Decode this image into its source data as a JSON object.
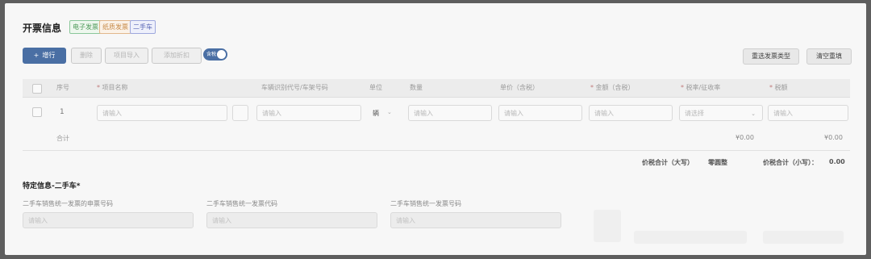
{
  "header": {
    "title": "开票信息",
    "tags": [
      "电子发票",
      "纸质发票",
      "二手车"
    ]
  },
  "toolbar": {
    "add_label": "增行",
    "delete_label": "删除",
    "import_label": "项目导入",
    "discount_label": "添加折扣",
    "toggle_label": "含税",
    "reselect_label": "重选发票类型",
    "clear_label": "清空重填"
  },
  "table": {
    "columns": [
      "序号",
      "项目名称",
      "车辆识别代号/车架号码",
      "单位",
      "数量",
      "单价（含税）",
      "金额（含税）",
      "税率/征收率",
      "税额"
    ],
    "row": {
      "index": "1",
      "name_placeholder": "请输入",
      "vin_placeholder": "请输入",
      "unit_value": "辆",
      "qty_placeholder": "请输入",
      "price_placeholder": "请输入",
      "amount_placeholder": "请输入",
      "rate_placeholder": "请选择",
      "tax_placeholder": "请输入"
    },
    "total_label": "合计",
    "total_amount": "¥0.00",
    "total_tax": "¥0.00"
  },
  "summary": {
    "upper_label": "价税合计（大写）",
    "upper_value": "零圆整",
    "lower_label": "价税合计（小写）：",
    "lower_value": "0.00"
  },
  "special": {
    "title": "特定信息-二手车*",
    "fields": [
      {
        "label": "二手车销售统一发票的申票号码",
        "placeholder": "请输入"
      },
      {
        "label": "二手车销售统一发票代码",
        "placeholder": "请输入"
      },
      {
        "label": "二手车销售统一发票号码",
        "placeholder": "请输入"
      }
    ]
  }
}
